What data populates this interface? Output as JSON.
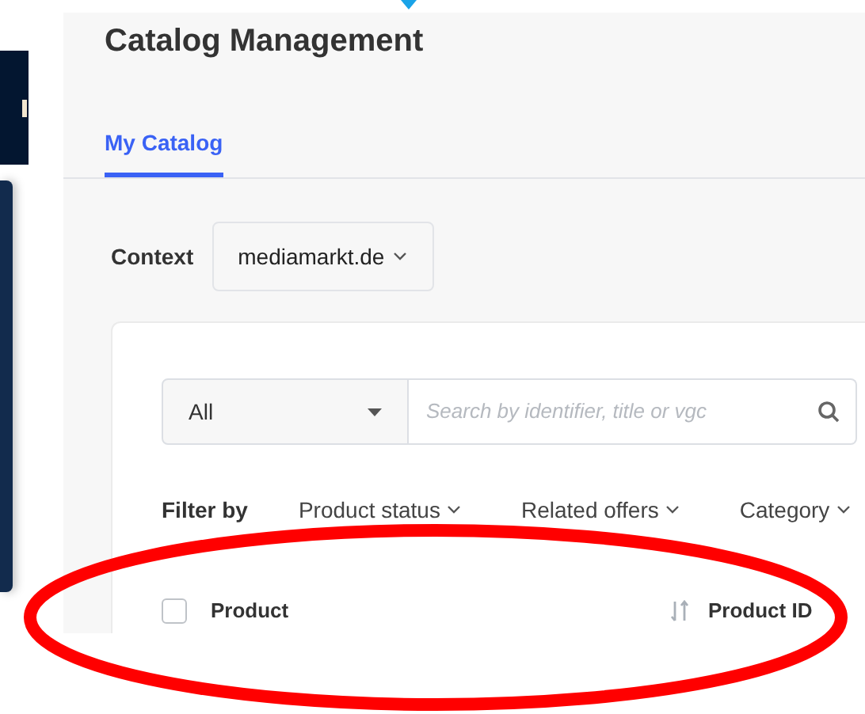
{
  "page": {
    "title": "Catalog Management"
  },
  "tabs": [
    {
      "label": "My Catalog",
      "selected": true
    }
  ],
  "context": {
    "label": "Context",
    "value": "mediamarkt.de"
  },
  "search": {
    "scope": "All",
    "placeholder": "Search by identifier, title or vgc"
  },
  "filters": {
    "label": "Filter by",
    "items": [
      "Product status",
      "Related offers",
      "Category"
    ]
  },
  "table": {
    "select_all": {
      "checked": false
    },
    "columns": [
      {
        "label": "Product",
        "sortable": false
      },
      {
        "label": "Product ID",
        "sortable": true
      }
    ]
  }
}
